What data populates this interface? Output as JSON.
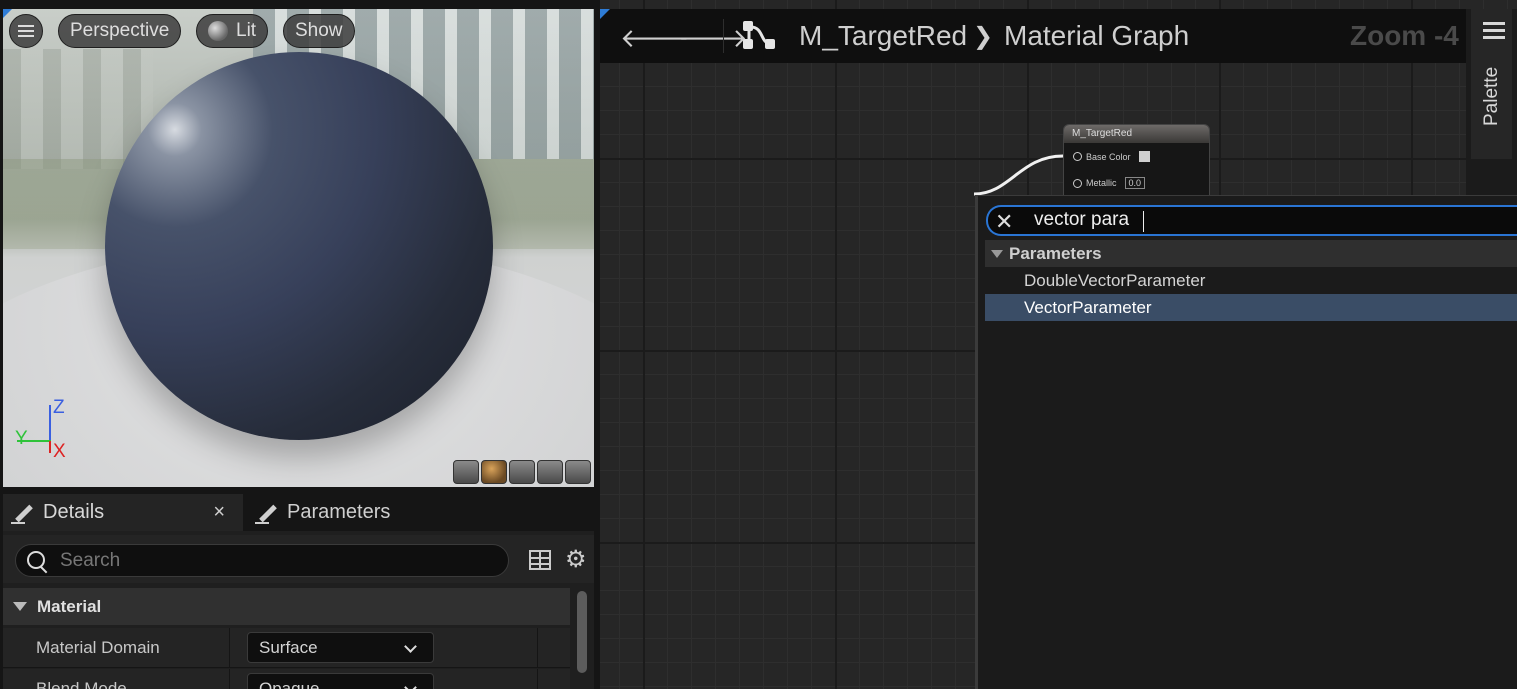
{
  "viewport": {
    "menu_icon": "hamburger-icon",
    "perspective_label": "Perspective",
    "lit_label": "Lit",
    "show_label": "Show",
    "axis_z": "Z",
    "axis_y": "Y",
    "axis_x": "X"
  },
  "details": {
    "tab_details": "Details",
    "tab_close": "×",
    "tab_parameters": "Parameters",
    "search_placeholder": "Search",
    "section_material": "Material",
    "rows": [
      {
        "name": "Material Domain",
        "value": "Surface"
      },
      {
        "name": "Blend Mode",
        "value": "Opaque"
      }
    ]
  },
  "graph": {
    "asset_name": "M_TargetRed",
    "breadcrumb_separator": "❯",
    "graph_name": "Material Graph",
    "zoom": "Zoom -4",
    "palette_label": "Palette",
    "node": {
      "title": "M_TargetRed",
      "pin_base_color": "Base Color",
      "pin_metallic": "Metallic",
      "metallic_value": "0.0"
    }
  },
  "popup": {
    "search_value": "vector para",
    "category": "Parameters",
    "items": [
      "DoubleVectorParameter",
      "VectorParameter"
    ],
    "selected_index": 1,
    "selection_color": "#3a4d66"
  },
  "colors": {
    "accent": "#2a75d4"
  }
}
